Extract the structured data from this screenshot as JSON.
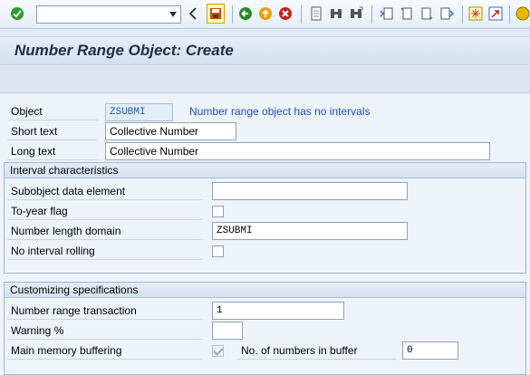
{
  "toolbar": {
    "command_field_value": "",
    "icons": [
      "enter-icon",
      "command-dropdown-icon",
      "back-icon",
      "save-icon",
      "back-nav-icon",
      "exit-icon",
      "cancel-icon",
      "print-icon",
      "find-icon",
      "find-next-icon",
      "first-page-icon",
      "previous-page-icon",
      "next-page-icon",
      "last-page-icon",
      "create-session-icon",
      "shortcut-icon",
      "help-icon"
    ]
  },
  "page": {
    "title": "Number Range Object: Create"
  },
  "header": {
    "object_label": "Object",
    "object_value": "ZSUBMI",
    "object_message": "Number range object has no intervals",
    "short_text_label": "Short text",
    "short_text_value": "Collective Number",
    "long_text_label": "Long text",
    "long_text_value": "Collective Number"
  },
  "interval": {
    "title": "Interval characteristics",
    "subobject_label": "Subobject data element",
    "subobject_value": "",
    "to_year_label": "To-year flag",
    "to_year_checked": false,
    "length_domain_label": "Number length domain",
    "length_domain_value": "ZSUBMI",
    "no_rolling_label": "No interval rolling",
    "no_rolling_checked": false
  },
  "customizing": {
    "title": "Customizing specifications",
    "transaction_label": "Number range transaction",
    "transaction_value": "1",
    "warning_label": "Warning %",
    "warning_value": "",
    "buffering_label": "Main memory buffering",
    "buffering_checked": true,
    "buffer_count_label": "No. of numbers in buffer",
    "buffer_count_value": "0"
  }
}
